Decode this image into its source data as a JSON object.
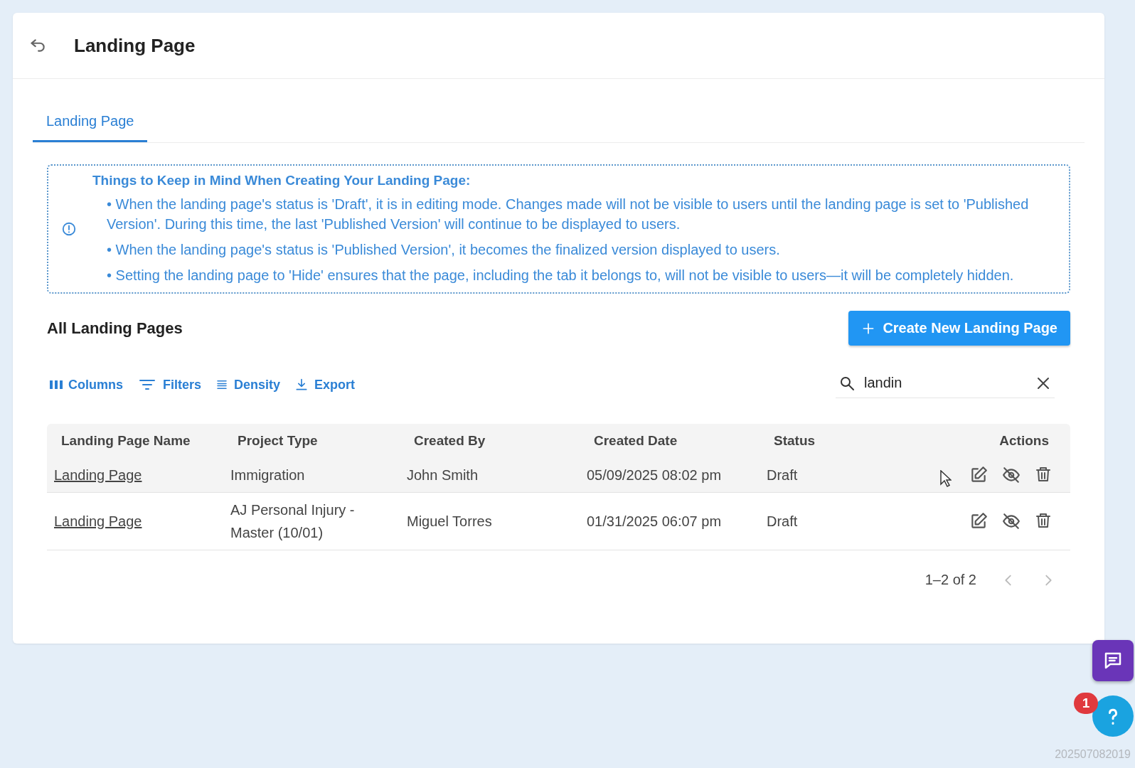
{
  "header": {
    "title": "Landing Page"
  },
  "tabs": [
    {
      "label": "Landing Page",
      "selected": true
    }
  ],
  "notice": {
    "title": "Things to Keep in Mind When Creating Your Landing Page:",
    "bullets": [
      "• When the landing page's status is 'Draft', it is in editing mode. Changes made will not be visible to users until the landing page is set to 'Published Version'. During this time, the last 'Published Version' will continue to be displayed to users.",
      "• When the landing page's status is 'Published Version', it becomes the finalized version displayed to users.",
      "• Setting the landing page to 'Hide' ensures that the page, including the tab it belongs to, will not be visible to users—it will be completely hidden."
    ]
  },
  "section": {
    "title": "All Landing Pages",
    "create_button": "Create New Landing Page"
  },
  "toolbar": [
    {
      "kind": "columns",
      "label": "Columns"
    },
    {
      "kind": "filters",
      "label": "Filters"
    },
    {
      "kind": "density",
      "label": "Density"
    },
    {
      "kind": "export",
      "label": "Export"
    }
  ],
  "search": {
    "value": "landin"
  },
  "table": {
    "columns": [
      "Landing Page Name",
      "Project Type",
      "Created By",
      "Created Date",
      "Status",
      "Actions"
    ],
    "rows": [
      {
        "name": "Landing Page",
        "project_type": "Immigration",
        "created_by": "John Smith",
        "created_date": "05/09/2025 08:02 pm",
        "status": "Draft",
        "highlighted": true
      },
      {
        "name": "Landing Page",
        "project_type": "AJ Personal Injury - Master (10/01)",
        "created_by": "Miguel Torres",
        "created_date": "01/31/2025 06:07 pm",
        "status": "Draft",
        "highlighted": false
      }
    ]
  },
  "pagination": {
    "range": "1–2 of 2",
    "prev_disabled": true,
    "next_disabled": true
  },
  "help": {
    "badge": "1"
  },
  "version": "202507082019"
}
